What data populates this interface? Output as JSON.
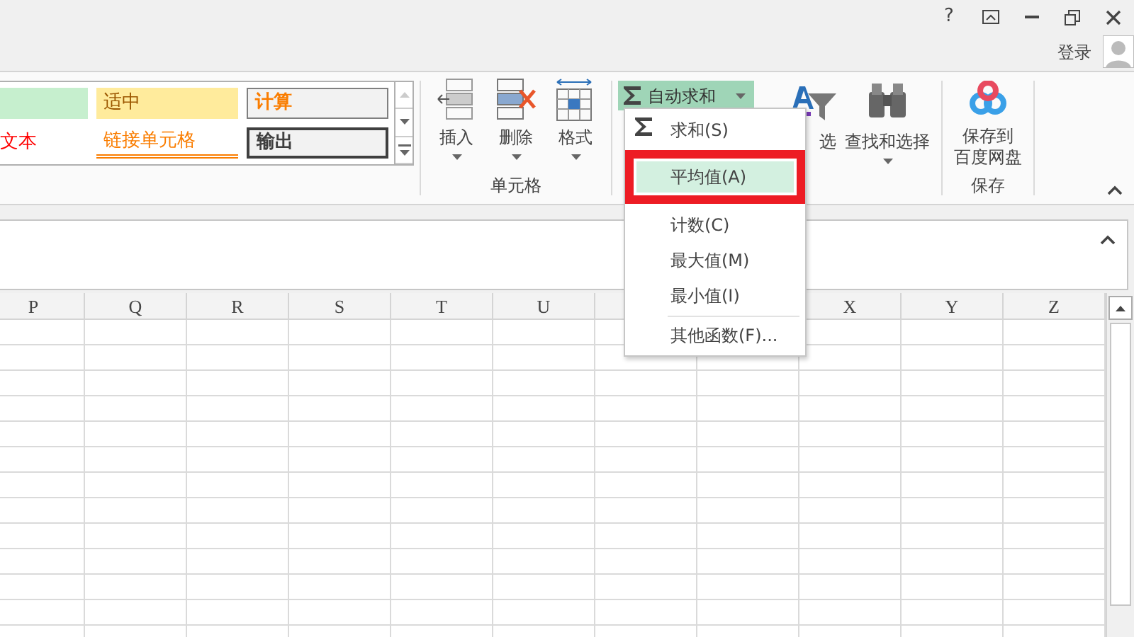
{
  "title_bar": {
    "help": "?",
    "sign_in": "登录"
  },
  "styles_gallery": {
    "cells": [
      {
        "kind": "good"
      },
      {
        "kind": "neutral",
        "label": "适中"
      },
      {
        "kind": "calc",
        "label": "计算"
      },
      {
        "kind": "warning",
        "label": "文本"
      },
      {
        "kind": "linked",
        "label": "链接单元格"
      },
      {
        "kind": "output",
        "label": "输出"
      }
    ]
  },
  "cells_group": {
    "label": "单元格",
    "buttons": [
      {
        "kind": "insert",
        "label": "插入"
      },
      {
        "kind": "delete",
        "label": "删除"
      },
      {
        "kind": "format",
        "label": "格式"
      }
    ]
  },
  "editing": {
    "autosum": {
      "label": "自动求和",
      "pressed": true
    },
    "sort_label": "选",
    "find_label": "查找和选择"
  },
  "save_group": {
    "button": [
      "保存到",
      "百度网盘"
    ],
    "label": "保存"
  },
  "autosum_menu": {
    "items": [
      {
        "label": "求和(S)",
        "kind": "sum",
        "selected": false
      },
      {
        "label": "平均值(A)",
        "selected": true
      },
      {
        "label": "计数(C)",
        "selected": false
      },
      {
        "label": "最大值(M)",
        "selected": false
      },
      {
        "label": "最小值(I)",
        "selected": false
      },
      {
        "label": "其他函数(F)...",
        "separator": true,
        "selected": false
      }
    ]
  },
  "sheet": {
    "columns": [
      "P",
      "Q",
      "R",
      "S",
      "T",
      "U",
      "X",
      "Y",
      "Z"
    ]
  }
}
